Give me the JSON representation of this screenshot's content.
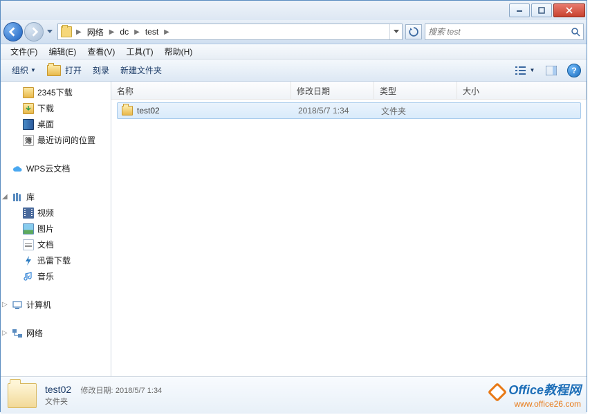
{
  "titlebar": {},
  "breadcrumb": {
    "seg1": "网络",
    "seg2": "dc",
    "seg3": "test"
  },
  "search": {
    "placeholder": "搜索 test"
  },
  "menubar": {
    "file": "文件(F)",
    "edit": "编辑(E)",
    "view": "查看(V)",
    "tools": "工具(T)",
    "help": "帮助(H)"
  },
  "toolbar": {
    "organize": "组织",
    "open": "打开",
    "burn": "刻录",
    "newfolder": "新建文件夹"
  },
  "sidebar": {
    "items": [
      {
        "label": "2345下载"
      },
      {
        "label": "下载"
      },
      {
        "label": "桌面"
      },
      {
        "label": "最近访问的位置"
      },
      {
        "label": "WPS云文档"
      },
      {
        "label": "库"
      },
      {
        "label": "视频"
      },
      {
        "label": "图片"
      },
      {
        "label": "文档"
      },
      {
        "label": "迅雷下载"
      },
      {
        "label": "音乐"
      },
      {
        "label": "计算机"
      },
      {
        "label": "网络"
      }
    ]
  },
  "columns": {
    "name": "名称",
    "date": "修改日期",
    "type": "类型",
    "size": "大小"
  },
  "files": {
    "row0": {
      "name": "test02",
      "date": "2018/5/7 1:34",
      "type": "文件夹"
    }
  },
  "details": {
    "name": "test02",
    "date_label": "修改日期:",
    "date": "2018/5/7 1:34",
    "type": "文件夹"
  },
  "watermark": {
    "brand": "Office",
    "brand_cn": "教程网",
    "url": "www.office26.com"
  }
}
